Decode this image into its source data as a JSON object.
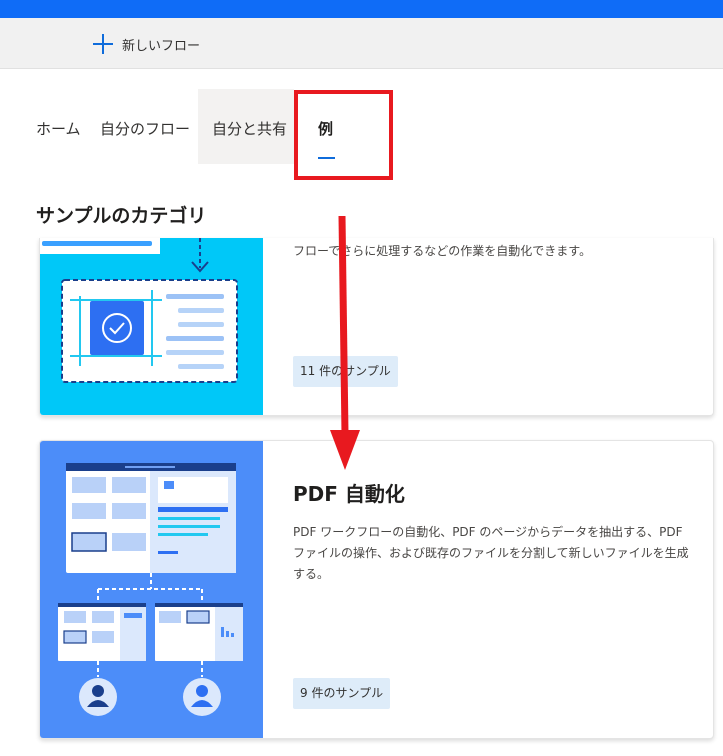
{
  "header": {
    "accent_color": "#0f6cf7",
    "new_flow_label": "新しいフロー",
    "new_flow_icon": "plus-icon"
  },
  "tabs": [
    {
      "label": "ホーム"
    },
    {
      "label": "自分のフロー"
    },
    {
      "label": "自分と共有"
    },
    {
      "label": "例",
      "selected": true
    }
  ],
  "section_title": "サンプルのカテゴリ",
  "cards": [
    {
      "description": "フローでさらに処理するなどの作業を自動化できます。",
      "badge": "11 件のサンプル",
      "art_color": "#00c8f8"
    },
    {
      "title": "PDF 自動化",
      "description": "PDF ワークフローの自動化、PDF のページからデータを抽出する、PDF ファイルの操作、および既存のファイルを分割して新しいファイルを生成する。",
      "badge": "9 件のサンプル",
      "art_color": "#4c8df9"
    }
  ],
  "annotation": {
    "color": "#e8191f"
  }
}
